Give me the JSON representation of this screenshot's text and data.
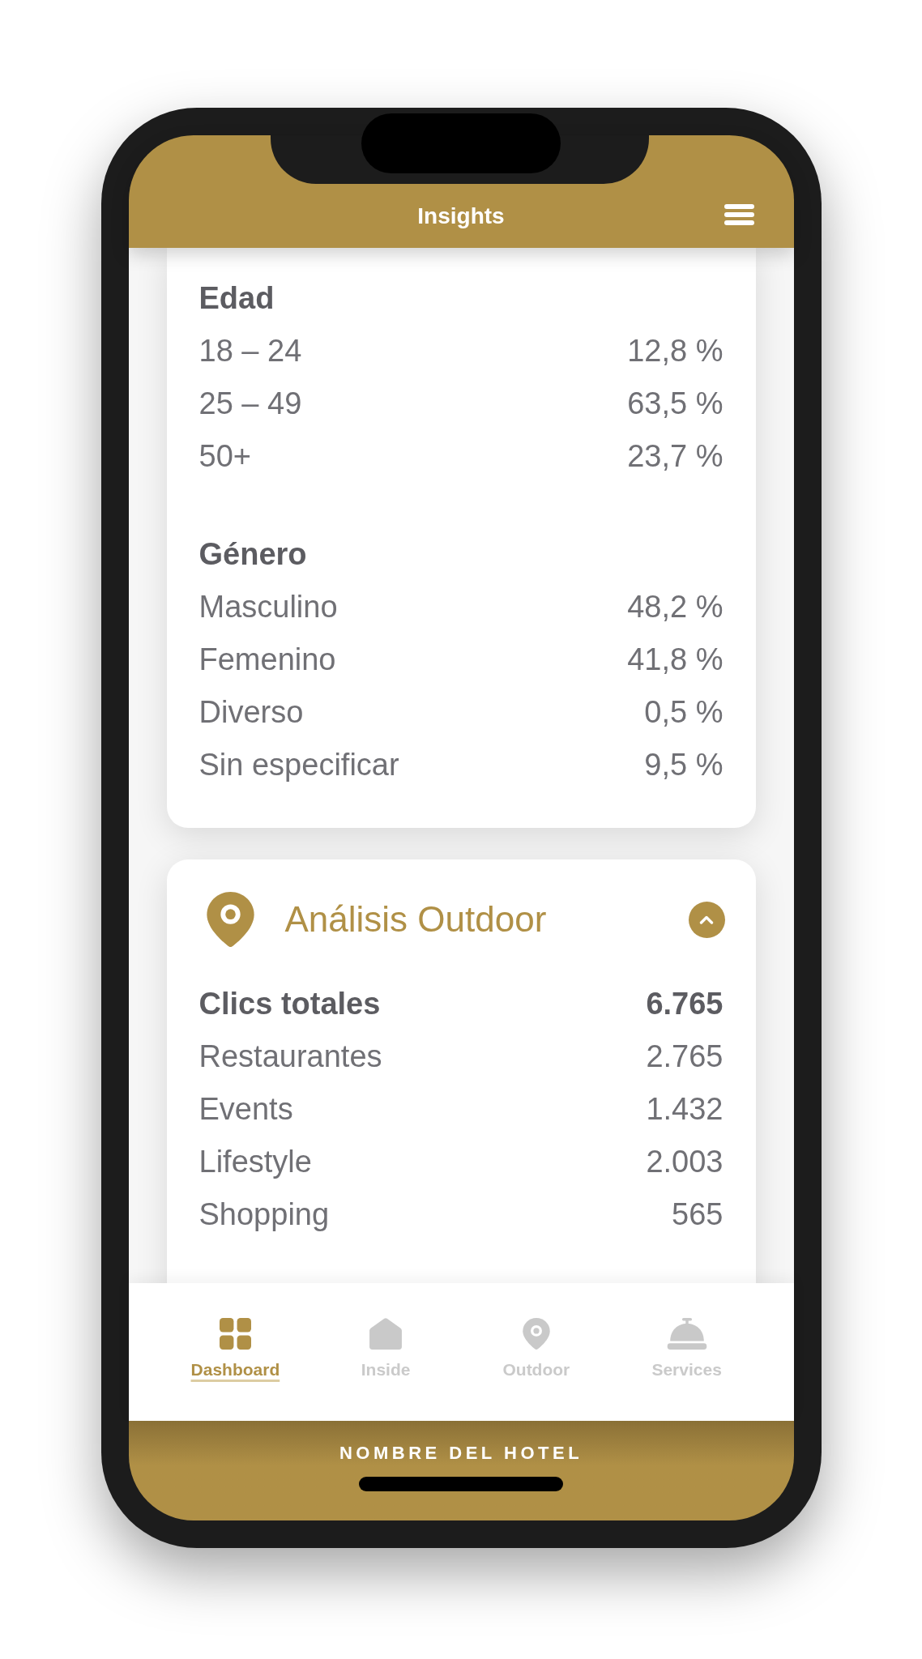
{
  "header": {
    "title": "Insights"
  },
  "audience_card": {
    "sections": [
      {
        "heading": "Edad",
        "rows": [
          {
            "label": "18 – 24",
            "value": "12,8 %"
          },
          {
            "label": "25 – 49",
            "value": "63,5 %"
          },
          {
            "label": "50+",
            "value": "23,7 %"
          }
        ]
      },
      {
        "heading": "Género",
        "rows": [
          {
            "label": "Masculino",
            "value": "48,2 %"
          },
          {
            "label": "Femenino",
            "value": "41,8 %"
          },
          {
            "label": "Diverso",
            "value": "0,5 %"
          },
          {
            "label": "Sin especificar",
            "value": "9,5 %"
          }
        ]
      }
    ]
  },
  "outdoor_card": {
    "title": "Análisis Outdoor",
    "expanded": true,
    "total": {
      "label": "Clics totales",
      "value": "6.765"
    },
    "rows": [
      {
        "label": "Restaurantes",
        "value": "2.765"
      },
      {
        "label": "Events",
        "value": "1.432"
      },
      {
        "label": "Lifestyle",
        "value": "2.003"
      },
      {
        "label": "Shopping",
        "value": "565"
      }
    ]
  },
  "bottom_nav": [
    {
      "label": "Dashboard",
      "selected": true
    },
    {
      "label": "Inside",
      "selected": false
    },
    {
      "label": "Outdoor",
      "selected": false
    },
    {
      "label": "Services",
      "selected": false
    }
  ],
  "footer": {
    "hotel_name": "NOMBRE DEL HOTEL"
  }
}
